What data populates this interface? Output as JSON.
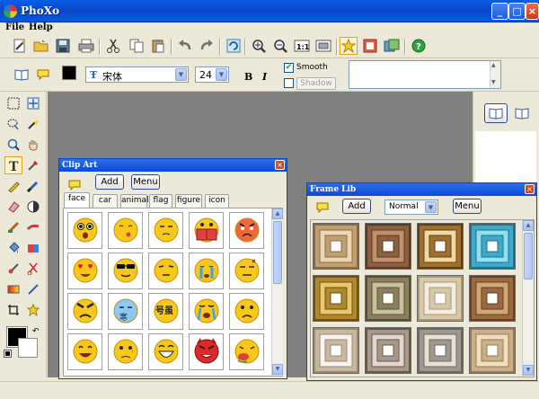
{
  "window": {
    "title": "PhoXo",
    "min": "_",
    "max": "□",
    "close": "×"
  },
  "menu": [
    {
      "label": "File"
    },
    {
      "label": "Help"
    }
  ],
  "format_bar": {
    "font": "宋体",
    "font_icon": "Ŧ",
    "size": "24",
    "bold": "B",
    "italic": "I",
    "smooth_label": "Smooth",
    "smooth_checked": true,
    "shadow_label": "Shadow",
    "shadow_checked": false,
    "color": "#000000"
  },
  "clipart": {
    "title": "Clip Art",
    "close": "×",
    "add": "Add",
    "menu": "Menu",
    "tabs": [
      {
        "label": "face"
      },
      {
        "label": "car"
      },
      {
        "label": "animal"
      },
      {
        "label": "flag"
      },
      {
        "label": "figure"
      },
      {
        "label": "icon"
      }
    ],
    "selected_tab": "face",
    "faces": [
      "shocked",
      "blowing",
      "sleepy",
      "book-reading",
      "angry-red",
      "heart-eyes",
      "cool-sunglasses",
      "squint",
      "crying-blue",
      "annoyed",
      "evil-frown",
      "frozen-cold",
      "dizzy-characters",
      "sobbing",
      "sad",
      "happy-grin",
      "sad-teary",
      "laughing",
      "devil-red",
      "puking"
    ],
    "face_chars": [
      "",
      "",
      "",
      "",
      "",
      "",
      "",
      "",
      "",
      "",
      "",
      "寒",
      "号虽",
      "",
      "",
      "",
      "",
      "",
      "",
      ""
    ]
  },
  "framelib": {
    "title": "Frame Lib",
    "close": "×",
    "add": "Add",
    "mode": "Normal",
    "menu": "Menu",
    "frames": [
      "tan-classic",
      "brown-wood",
      "gold-pyramid",
      "aqua-ornate",
      "gold-classic",
      "olive-grey",
      "beige-lace",
      "brown-carved",
      "sepia-fade",
      "taupe-marble",
      "grey-gold",
      "sand-beige"
    ]
  },
  "statusbar": {
    "text": ""
  }
}
